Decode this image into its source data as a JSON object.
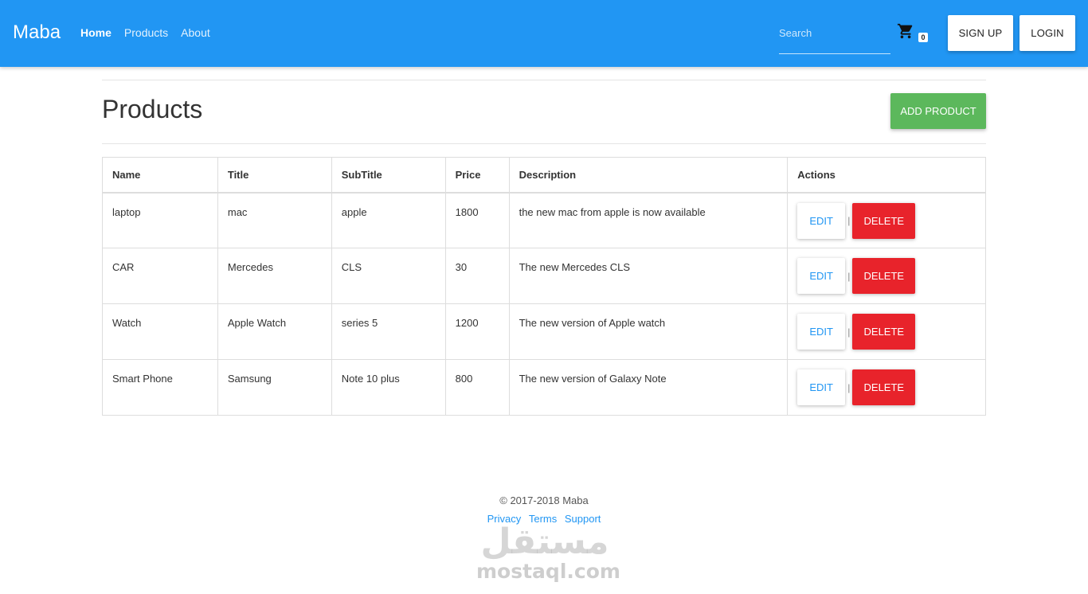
{
  "navbar": {
    "brand": "Maba",
    "links": [
      {
        "label": "Home",
        "active": true
      },
      {
        "label": "Products",
        "active": false
      },
      {
        "label": "About",
        "active": false
      }
    ],
    "search_placeholder": "Search",
    "cart_icon": "shopping-cart-icon",
    "cart_count": "0",
    "signup_label": "SIGN UP",
    "login_label": "LOGIN",
    "color": "#2196f3"
  },
  "main": {
    "title": "Products",
    "add_label": "ADD PRODUCT",
    "add_color": "#5cb85c",
    "table": {
      "headers": [
        "Name",
        "Title",
        "SubTitle",
        "Price",
        "Description",
        "Actions"
      ],
      "rows": [
        {
          "name": "laptop",
          "title": "mac",
          "subtitle": "apple",
          "price": "1800",
          "description": "the new mac from apple is now available"
        },
        {
          "name": "CAR",
          "title": "Mercedes",
          "subtitle": "CLS",
          "price": "30",
          "description": "The new Mercedes CLS"
        },
        {
          "name": "Watch",
          "title": "Apple Watch",
          "subtitle": "series 5",
          "price": "1200",
          "description": "The new version of Apple watch"
        },
        {
          "name": "Smart Phone",
          "title": "Samsung",
          "subtitle": "Note 10 plus",
          "price": "800",
          "description": "The new version of Galaxy Note"
        }
      ],
      "edit_label": "EDIT",
      "separator": "|",
      "delete_label": "DELETE",
      "delete_color": "#e8232b"
    }
  },
  "footer": {
    "copyright": "© 2017-2018 Maba",
    "links": [
      "Privacy",
      "Terms",
      "Support"
    ]
  },
  "watermark": {
    "arabic": "مستقل",
    "latin": "mostaql.com"
  }
}
